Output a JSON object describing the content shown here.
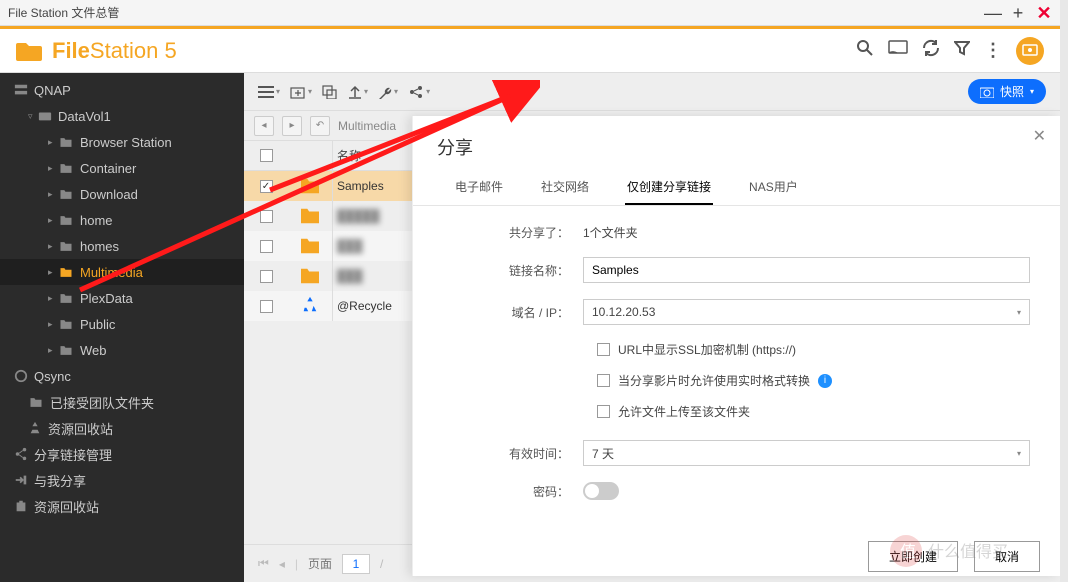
{
  "window": {
    "title": "File Station 文件总管"
  },
  "app": {
    "name_bold": "File",
    "name_rest": "Station 5"
  },
  "snapshot_btn": "快照",
  "sidebar": {
    "items": [
      {
        "icon": "storage",
        "label": "QNAP"
      },
      {
        "indent": 1,
        "caret": "▿",
        "icon": "drive",
        "label": "DataVol1"
      },
      {
        "indent": 2,
        "caret": "▸",
        "icon": "folder",
        "label": "Browser Station"
      },
      {
        "indent": 2,
        "caret": "▸",
        "icon": "folder",
        "label": "Container"
      },
      {
        "indent": 2,
        "caret": "▸",
        "icon": "folder",
        "label": "Download"
      },
      {
        "indent": 2,
        "caret": "▸",
        "icon": "folder",
        "label": "home"
      },
      {
        "indent": 2,
        "caret": "▸",
        "icon": "folder",
        "label": "homes"
      },
      {
        "indent": 2,
        "caret": "▸",
        "icon": "folder",
        "label": "Multimedia",
        "selected": true
      },
      {
        "indent": 2,
        "caret": "▸",
        "icon": "folder",
        "label": "PlexData"
      },
      {
        "indent": 2,
        "caret": "▸",
        "icon": "folder",
        "label": "Public"
      },
      {
        "indent": 2,
        "caret": "▸",
        "icon": "folder",
        "label": "Web"
      },
      {
        "icon": "qsync",
        "label": "Qsync"
      },
      {
        "indent": 1,
        "icon": "folder",
        "label": "已接受团队文件夹"
      },
      {
        "indent": 1,
        "icon": "recycle",
        "label": "资源回收站"
      },
      {
        "icon": "share",
        "label": "分享链接管理"
      },
      {
        "icon": "share-in",
        "label": "与我分享"
      },
      {
        "icon": "trash",
        "label": "资源回收站"
      }
    ]
  },
  "breadcrumb": {
    "path": "Multimedia"
  },
  "list": {
    "header_name": "名称",
    "rows": [
      {
        "name": "Samples",
        "selected": true,
        "type": "folder"
      },
      {
        "name": "█████",
        "type": "folder",
        "blur": true
      },
      {
        "name": "███",
        "type": "folder",
        "blur": true
      },
      {
        "name": "███",
        "type": "folder",
        "blur": true
      },
      {
        "name": "@Recycle",
        "type": "recycle"
      }
    ]
  },
  "pager": {
    "label": "页面",
    "current": "1"
  },
  "popup": {
    "title": "分享",
    "tabs": [
      "电子邮件",
      "社交网络",
      "仅创建分享链接",
      "NAS用户"
    ],
    "active_tab": 2,
    "summary_label": "共分享了：",
    "summary_value": "1个文件夹",
    "linkname_label": "链接名称：",
    "linkname_value": "Samples",
    "domain_label": "域名 / IP：",
    "domain_value": "10.12.20.53",
    "opt_ssl": "URL中显示SSL加密机制 (https://)",
    "opt_transcode": "当分享影片时允许使用实时格式转换",
    "opt_upload": "允许文件上传至该文件夹",
    "valid_label": "有效时间：",
    "valid_value": "7 天",
    "password_label": "密码：",
    "btn_create": "立即创建",
    "btn_cancel": "取消"
  },
  "watermark": "什么值得买"
}
